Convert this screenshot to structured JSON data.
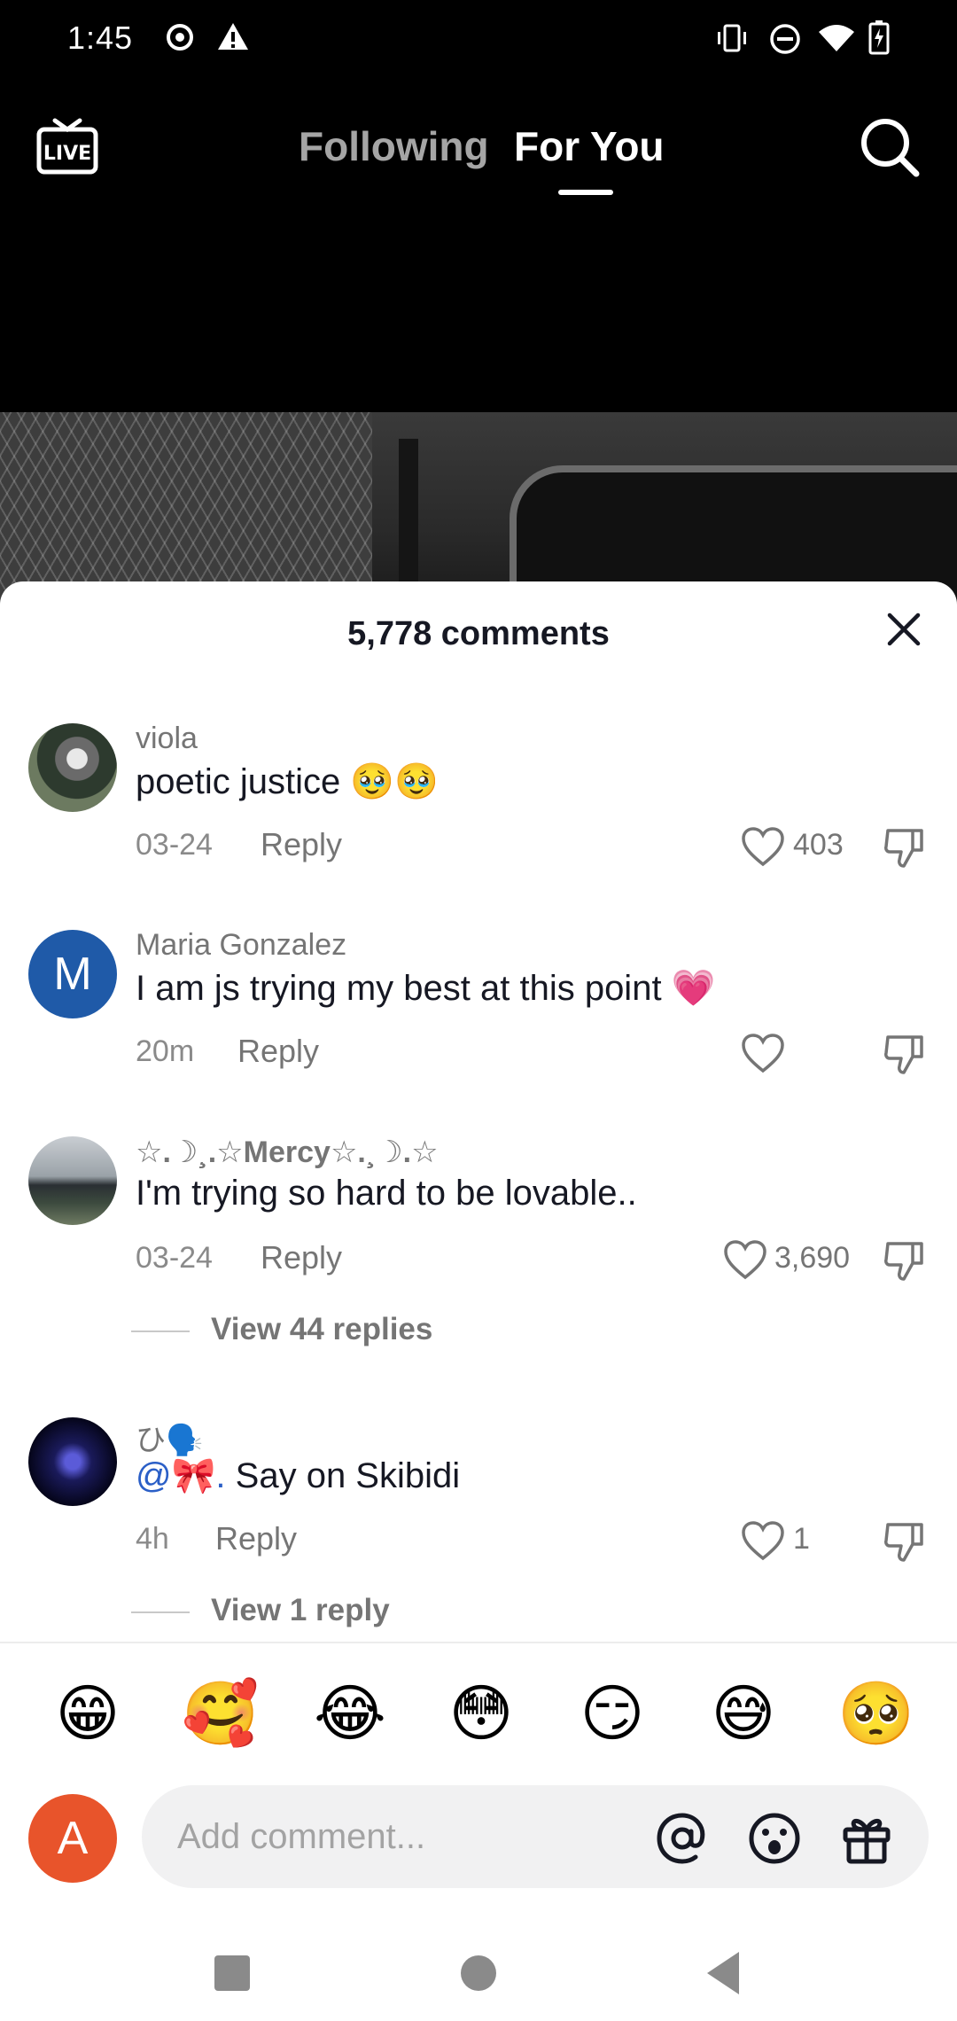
{
  "status_bar": {
    "time": "1:45"
  },
  "top_nav": {
    "tabs": [
      {
        "label": "Following",
        "active": false
      },
      {
        "label": "For You",
        "active": true
      }
    ]
  },
  "comments_sheet": {
    "title": "5,778 comments",
    "comments": [
      {
        "username": "viola",
        "text": "poetic justice 🥹🥹",
        "date": "03-24",
        "reply_label": "Reply",
        "likes": "403"
      },
      {
        "username": "Maria Gonzalez",
        "avatar_letter": "M",
        "text": "I am js trying my best at this point 💗",
        "date": "20m",
        "reply_label": "Reply",
        "likes": ""
      },
      {
        "username": "☆.☽¸.☆Mercy☆.¸☽.☆",
        "text": "I'm trying so hard to be lovable..",
        "date": "03-24",
        "reply_label": "Reply",
        "likes": "3,690",
        "view_replies": "View 44 replies"
      },
      {
        "username": "ひ🗣️",
        "mention": "@🎀.",
        "text": "Say on Skibidi",
        "date": "4h",
        "reply_label": "Reply",
        "likes": "1",
        "view_replies": "View 1 reply"
      }
    ]
  },
  "emoji_bar": [
    "😁",
    "🥰",
    "😂",
    "😳",
    "😏",
    "😅",
    "🥺"
  ],
  "composer": {
    "avatar_letter": "A",
    "placeholder": "Add comment..."
  },
  "colors": {
    "accent_avatar": "#1f5aa8",
    "me_avatar": "#e8542b",
    "mention": "#2b5fc7"
  }
}
